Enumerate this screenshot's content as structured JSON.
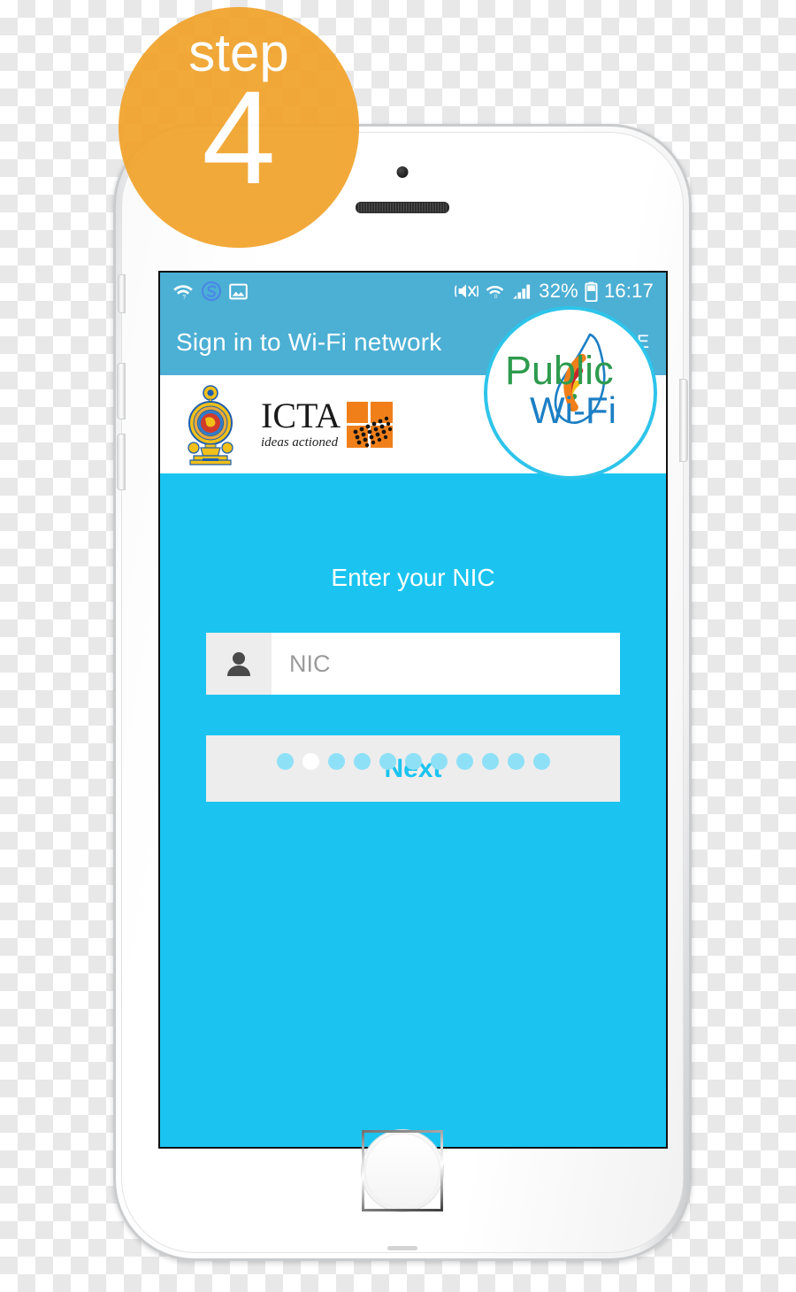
{
  "badge": {
    "word": "step",
    "number": "4",
    "color": "#F1A42E"
  },
  "device": {
    "type": "white-smartphone",
    "home_button": "home-button",
    "buttons": [
      "mute-switch",
      "volume-up",
      "volume-down",
      "power"
    ]
  },
  "screen": {
    "status_bar": {
      "background": "#4CAFD4",
      "left_icons": [
        "wifi-question-icon",
        "s-app-icon",
        "image-icon"
      ],
      "right_icons": [
        "vibrate-mute-icon",
        "wifi-icon",
        "signal-bars-icon",
        "battery-icon"
      ],
      "battery_percent": "32%",
      "time": "16:17"
    },
    "app_bar": {
      "title": "Sign in to Wi-Fi network",
      "more_label": "MORE",
      "background": "#4CAFD4"
    },
    "logo_band": {
      "background": "#ffffff",
      "emblem": "sri-lanka-government-emblem",
      "icta_name": "ICTA",
      "icta_tagline": "ideas actioned"
    },
    "brand_logo": {
      "line1": "Public",
      "line2": "Wi-Fi",
      "line1_color": "#2E9B4E",
      "line2_color": "#1C7FC4",
      "ring_color": "#2ec4ea"
    },
    "body": {
      "background": "#1BC4F0",
      "headline": "Enter your NIC",
      "nic_input": {
        "placeholder": "NIC",
        "value": "",
        "icon": "person-icon"
      },
      "next_label": "Next",
      "next_text_color": "#1BC4F0"
    },
    "pagination": {
      "total": 11,
      "active_index": 1,
      "dot_color": "#8ee0f7",
      "active_color": "#ffffff"
    }
  }
}
